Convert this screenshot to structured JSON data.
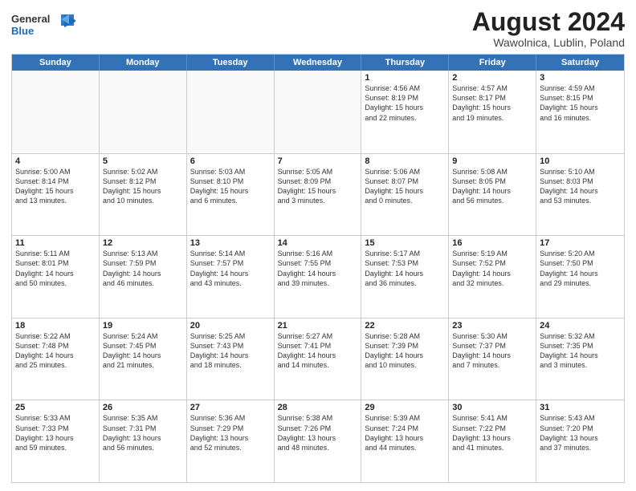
{
  "header": {
    "logo_line1": "General",
    "logo_line2": "Blue",
    "month_year": "August 2024",
    "location": "Wawolnica, Lublin, Poland"
  },
  "weekdays": [
    "Sunday",
    "Monday",
    "Tuesday",
    "Wednesday",
    "Thursday",
    "Friday",
    "Saturday"
  ],
  "weeks": [
    [
      {
        "day": "",
        "info": ""
      },
      {
        "day": "",
        "info": ""
      },
      {
        "day": "",
        "info": ""
      },
      {
        "day": "",
        "info": ""
      },
      {
        "day": "1",
        "info": "Sunrise: 4:56 AM\nSunset: 8:19 PM\nDaylight: 15 hours\nand 22 minutes."
      },
      {
        "day": "2",
        "info": "Sunrise: 4:57 AM\nSunset: 8:17 PM\nDaylight: 15 hours\nand 19 minutes."
      },
      {
        "day": "3",
        "info": "Sunrise: 4:59 AM\nSunset: 8:15 PM\nDaylight: 15 hours\nand 16 minutes."
      }
    ],
    [
      {
        "day": "4",
        "info": "Sunrise: 5:00 AM\nSunset: 8:14 PM\nDaylight: 15 hours\nand 13 minutes."
      },
      {
        "day": "5",
        "info": "Sunrise: 5:02 AM\nSunset: 8:12 PM\nDaylight: 15 hours\nand 10 minutes."
      },
      {
        "day": "6",
        "info": "Sunrise: 5:03 AM\nSunset: 8:10 PM\nDaylight: 15 hours\nand 6 minutes."
      },
      {
        "day": "7",
        "info": "Sunrise: 5:05 AM\nSunset: 8:09 PM\nDaylight: 15 hours\nand 3 minutes."
      },
      {
        "day": "8",
        "info": "Sunrise: 5:06 AM\nSunset: 8:07 PM\nDaylight: 15 hours\nand 0 minutes."
      },
      {
        "day": "9",
        "info": "Sunrise: 5:08 AM\nSunset: 8:05 PM\nDaylight: 14 hours\nand 56 minutes."
      },
      {
        "day": "10",
        "info": "Sunrise: 5:10 AM\nSunset: 8:03 PM\nDaylight: 14 hours\nand 53 minutes."
      }
    ],
    [
      {
        "day": "11",
        "info": "Sunrise: 5:11 AM\nSunset: 8:01 PM\nDaylight: 14 hours\nand 50 minutes."
      },
      {
        "day": "12",
        "info": "Sunrise: 5:13 AM\nSunset: 7:59 PM\nDaylight: 14 hours\nand 46 minutes."
      },
      {
        "day": "13",
        "info": "Sunrise: 5:14 AM\nSunset: 7:57 PM\nDaylight: 14 hours\nand 43 minutes."
      },
      {
        "day": "14",
        "info": "Sunrise: 5:16 AM\nSunset: 7:55 PM\nDaylight: 14 hours\nand 39 minutes."
      },
      {
        "day": "15",
        "info": "Sunrise: 5:17 AM\nSunset: 7:53 PM\nDaylight: 14 hours\nand 36 minutes."
      },
      {
        "day": "16",
        "info": "Sunrise: 5:19 AM\nSunset: 7:52 PM\nDaylight: 14 hours\nand 32 minutes."
      },
      {
        "day": "17",
        "info": "Sunrise: 5:20 AM\nSunset: 7:50 PM\nDaylight: 14 hours\nand 29 minutes."
      }
    ],
    [
      {
        "day": "18",
        "info": "Sunrise: 5:22 AM\nSunset: 7:48 PM\nDaylight: 14 hours\nand 25 minutes."
      },
      {
        "day": "19",
        "info": "Sunrise: 5:24 AM\nSunset: 7:45 PM\nDaylight: 14 hours\nand 21 minutes."
      },
      {
        "day": "20",
        "info": "Sunrise: 5:25 AM\nSunset: 7:43 PM\nDaylight: 14 hours\nand 18 minutes."
      },
      {
        "day": "21",
        "info": "Sunrise: 5:27 AM\nSunset: 7:41 PM\nDaylight: 14 hours\nand 14 minutes."
      },
      {
        "day": "22",
        "info": "Sunrise: 5:28 AM\nSunset: 7:39 PM\nDaylight: 14 hours\nand 10 minutes."
      },
      {
        "day": "23",
        "info": "Sunrise: 5:30 AM\nSunset: 7:37 PM\nDaylight: 14 hours\nand 7 minutes."
      },
      {
        "day": "24",
        "info": "Sunrise: 5:32 AM\nSunset: 7:35 PM\nDaylight: 14 hours\nand 3 minutes."
      }
    ],
    [
      {
        "day": "25",
        "info": "Sunrise: 5:33 AM\nSunset: 7:33 PM\nDaylight: 13 hours\nand 59 minutes."
      },
      {
        "day": "26",
        "info": "Sunrise: 5:35 AM\nSunset: 7:31 PM\nDaylight: 13 hours\nand 56 minutes."
      },
      {
        "day": "27",
        "info": "Sunrise: 5:36 AM\nSunset: 7:29 PM\nDaylight: 13 hours\nand 52 minutes."
      },
      {
        "day": "28",
        "info": "Sunrise: 5:38 AM\nSunset: 7:26 PM\nDaylight: 13 hours\nand 48 minutes."
      },
      {
        "day": "29",
        "info": "Sunrise: 5:39 AM\nSunset: 7:24 PM\nDaylight: 13 hours\nand 44 minutes."
      },
      {
        "day": "30",
        "info": "Sunrise: 5:41 AM\nSunset: 7:22 PM\nDaylight: 13 hours\nand 41 minutes."
      },
      {
        "day": "31",
        "info": "Sunrise: 5:43 AM\nSunset: 7:20 PM\nDaylight: 13 hours\nand 37 minutes."
      }
    ]
  ]
}
